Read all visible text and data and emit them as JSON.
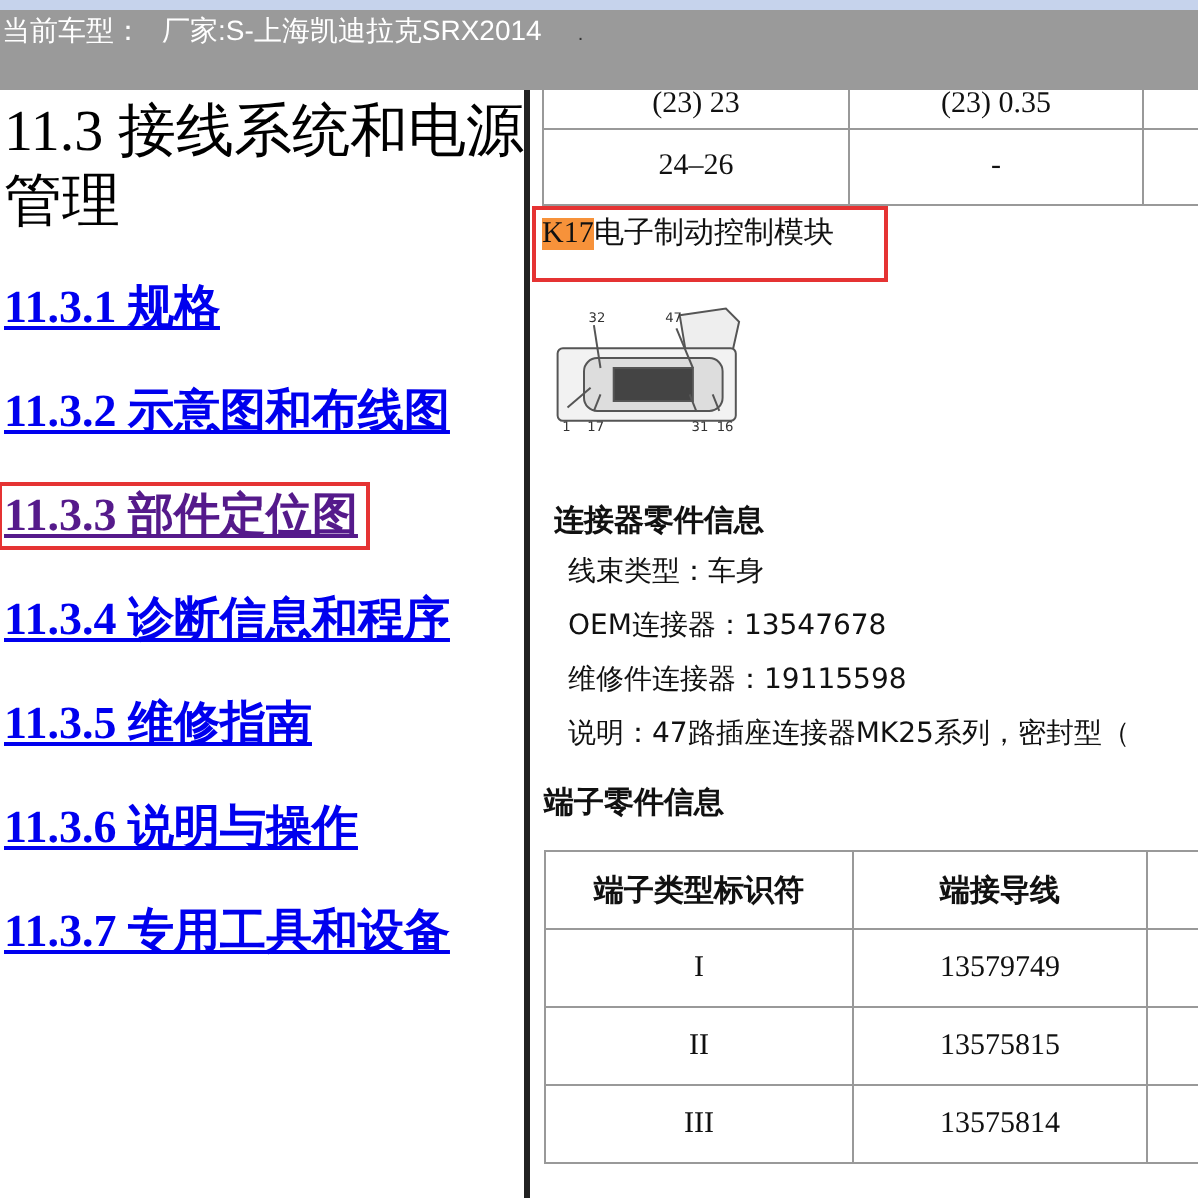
{
  "top_bar": {
    "label": "当前车型：",
    "vehicle": "厂家:S-上海凯迪拉克SRX2014",
    "mark": "."
  },
  "toc": {
    "title": "11.3 接线系统和电源管理",
    "links": [
      {
        "number": "11.3.1",
        "text": "规格",
        "visited": false,
        "highlighted": false
      },
      {
        "number": "11.3.2",
        "text": "示意图和布线图",
        "visited": false,
        "highlighted": false
      },
      {
        "number": "11.3.3",
        "text": "部件定位图",
        "visited": true,
        "highlighted": true
      },
      {
        "number": "11.3.4",
        "text": "诊断信息和程序",
        "visited": false,
        "highlighted": false
      },
      {
        "number": "11.3.5",
        "text": "维修指南",
        "visited": false,
        "highlighted": false
      },
      {
        "number": "11.3.6",
        "text": "说明与操作",
        "visited": false,
        "highlighted": false
      },
      {
        "number": "11.3.7",
        "text": "专用工具和设备",
        "visited": false,
        "highlighted": false
      }
    ]
  },
  "document": {
    "upper_table": {
      "rows": [
        [
          "(23) 23",
          "(23) 0.35"
        ],
        [
          "24–26",
          "-"
        ]
      ]
    },
    "component": {
      "code": "K17",
      "code_highlighted": true,
      "name": "电子制动控制模块",
      "highlighted": true
    },
    "connector_pins": [
      "32",
      "47",
      "1",
      "17",
      "31",
      "16"
    ],
    "connector_info": {
      "heading": "连接器零件信息",
      "lines": [
        "线束类型：车身",
        "OEM连接器：13547678",
        "维修件连接器：19115598",
        "说明：47路插座连接器MK25系列，密封型（"
      ]
    },
    "terminal_info": {
      "heading": "端子零件信息",
      "columns": [
        "端子类型标识符",
        "端接导线"
      ],
      "rows": [
        [
          "I",
          "13579749"
        ],
        [
          "II",
          "13575815"
        ],
        [
          "III",
          "13575814"
        ]
      ]
    }
  }
}
